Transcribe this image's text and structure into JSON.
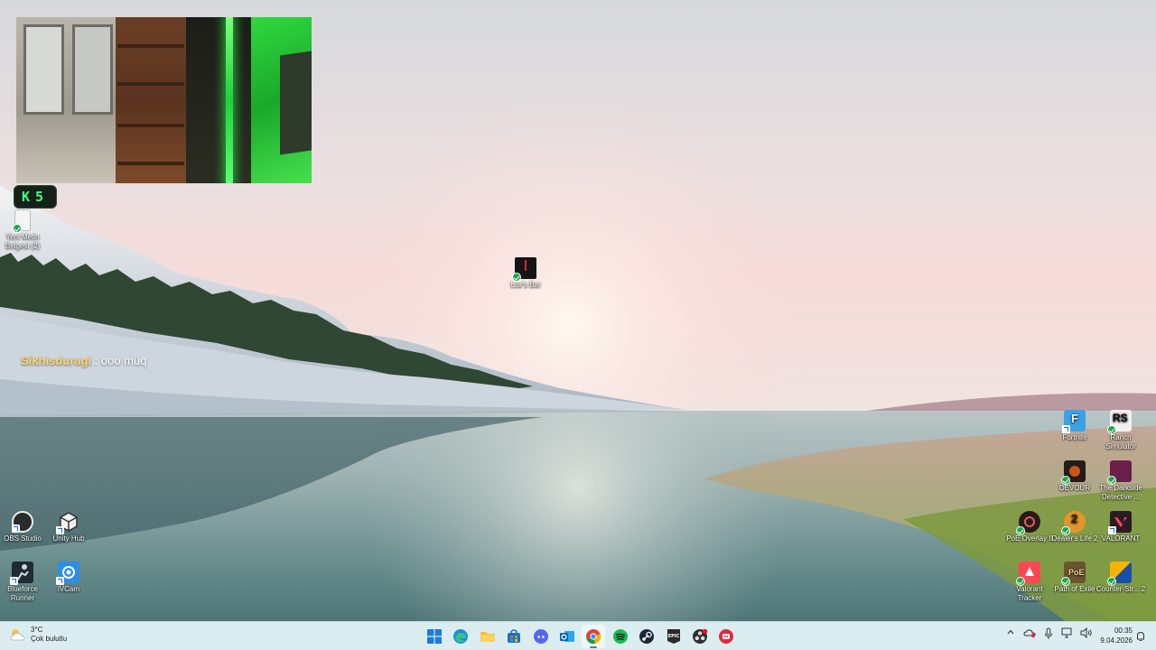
{
  "desktop": {
    "left_icons": [
      {
        "label": "Yeni Metin Belgesi (2)"
      },
      {
        "label": "OBS Studio"
      },
      {
        "label": "Unity Hub"
      },
      {
        "label": "Blueforce Runner"
      },
      {
        "label": "iVCam"
      }
    ],
    "center_icons": [
      {
        "label": "Liar's Bar"
      }
    ],
    "right_icons": [
      {
        "label": "Fortnite"
      },
      {
        "label": "Ranch Simulator"
      },
      {
        "label": "DEVOUR"
      },
      {
        "label": "The Darkside Detective ..."
      },
      {
        "label": "PoE Overlay II"
      },
      {
        "label": "Dealer's Life 2"
      },
      {
        "label": "VALORANT"
      },
      {
        "label": "Valorant Tracker"
      },
      {
        "label": "Path of Exile"
      },
      {
        "label": "Counter-Str... 2"
      }
    ]
  },
  "overlays": {
    "badge_text": "K5",
    "chat": {
      "user": "Sikhisduragi",
      "separator": " : ",
      "message": "ooo müq"
    }
  },
  "taskbar": {
    "weather": {
      "temp": "3°C",
      "condition": "Çok bulutlu",
      "icon": "cloud-sun-icon"
    },
    "apps": [
      {
        "name": "start",
        "icon": "windows-logo-icon"
      },
      {
        "name": "edge",
        "icon": "edge-icon"
      },
      {
        "name": "file-explorer",
        "icon": "folder-icon"
      },
      {
        "name": "store",
        "icon": "store-icon"
      },
      {
        "name": "discord",
        "icon": "discord-icon"
      },
      {
        "name": "outlook",
        "icon": "outlook-icon"
      },
      {
        "name": "chrome",
        "icon": "chrome-icon"
      },
      {
        "name": "spotify",
        "icon": "spotify-icon"
      },
      {
        "name": "steam",
        "icon": "steam-icon"
      },
      {
        "name": "epic-games",
        "icon": "epic-games-icon"
      },
      {
        "name": "obs",
        "icon": "obs-icon"
      },
      {
        "name": "app-red",
        "icon": "red-app-icon"
      }
    ],
    "clock": {
      "time": "00:35",
      "date": "9.04.2026"
    },
    "colors": {
      "taskbar_bg": "#dcedf2",
      "accent": "#1a66d0"
    }
  }
}
